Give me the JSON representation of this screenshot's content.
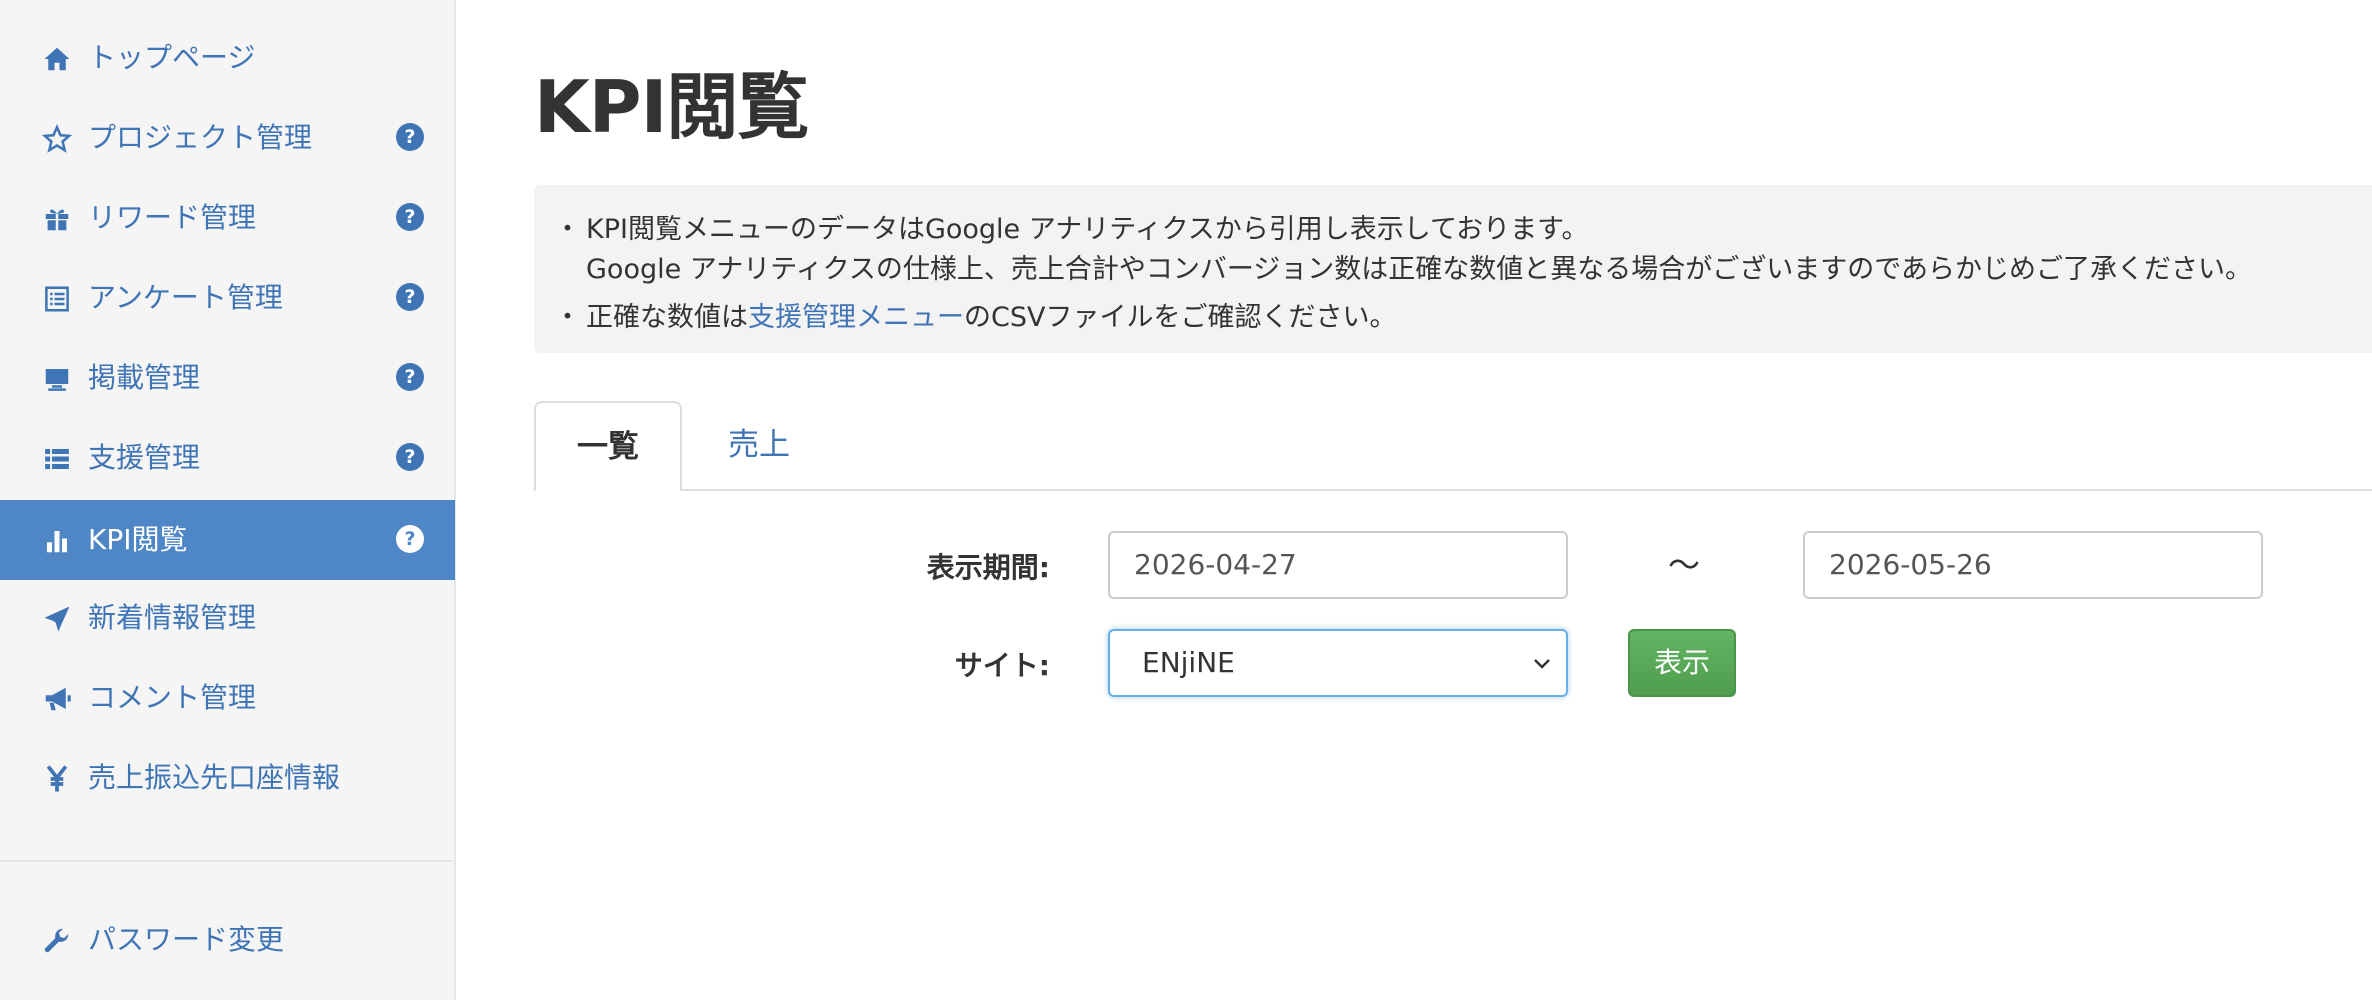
{
  "sidebar": {
    "items": [
      {
        "label": "トップページ",
        "icon": "home-icon"
      },
      {
        "label": "プロジェクト管理",
        "icon": "star-icon",
        "help": "?"
      },
      {
        "label": "リワード管理",
        "icon": "gift-icon",
        "help": "?"
      },
      {
        "label": "アンケート管理",
        "icon": "list-alt-icon",
        "help": "?"
      },
      {
        "label": "掲載管理",
        "icon": "monitor-icon",
        "help": "?"
      },
      {
        "label": "支援管理",
        "icon": "list-icon",
        "help": "?"
      },
      {
        "label": "KPI閲覧",
        "icon": "bar-chart-icon",
        "help": "?",
        "active": true
      },
      {
        "label": "新着情報管理",
        "icon": "paper-plane-icon"
      },
      {
        "label": "コメント管理",
        "icon": "megaphone-icon"
      },
      {
        "label": "売上振込先口座情報",
        "icon": "yen-icon"
      }
    ],
    "footer_items": [
      {
        "label": "パスワード変更",
        "icon": "wrench-icon"
      }
    ]
  },
  "main": {
    "title": "KPI閲覧",
    "notice": {
      "bullet1_line1": "KPI閲覧メニューのデータはGoogle アナリティクスから引用し表示しております。",
      "bullet1_line2": "Google アナリティクスの仕様上、売上合計やコンバージョン数は正確な数値と異なる場合がございますのであらかじめご了承ください。",
      "bullet2_prefix": "正確な数値は",
      "bullet2_link": "支援管理メニュー",
      "bullet2_suffix": "のCSVファイルをご確認ください。",
      "bullet_mark": "・"
    },
    "tabs": [
      {
        "label": "一覧",
        "active": true
      },
      {
        "label": "売上",
        "active": false
      }
    ],
    "form": {
      "period_label": "表示期間:",
      "date_from": "2026-04-27",
      "range_separator": "〜",
      "date_to": "2026-05-26",
      "site_label": "サイト:",
      "site_selected": "ENjiNE",
      "submit_label": "表示"
    }
  },
  "colors": {
    "link": "#3f74b5",
    "active_nav_bg": "#4f87c6",
    "button_green": "#5cad5c",
    "sidebar_bg": "#f5f5f5",
    "notice_bg": "#f3f3f3"
  }
}
